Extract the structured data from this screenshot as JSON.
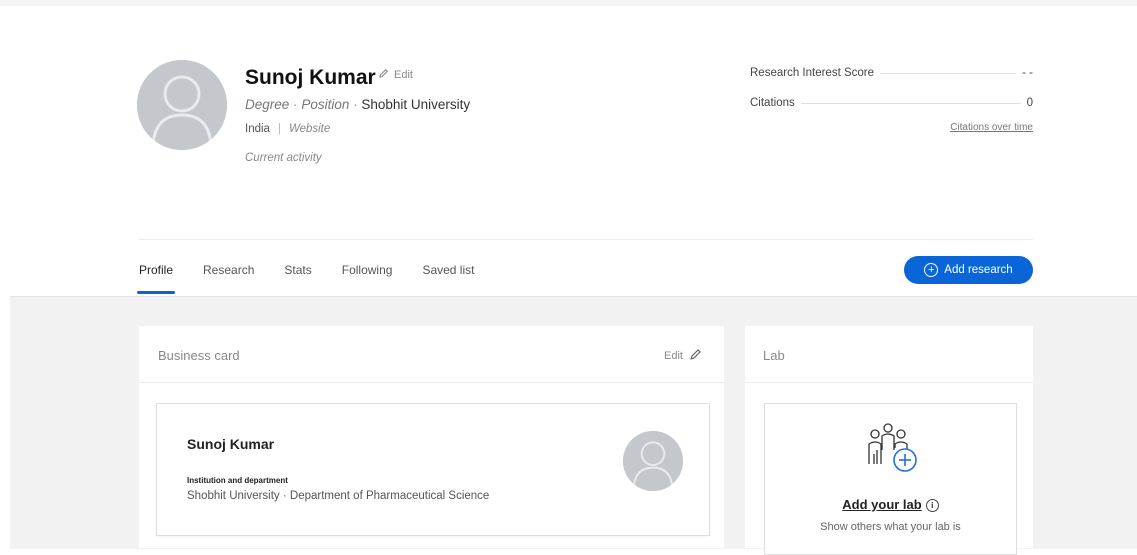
{
  "profile": {
    "name": "Sunoj Kumar",
    "edit_label": "Edit",
    "degree": "Degree",
    "position": "Position",
    "sep": "·",
    "university": "Shobhit University",
    "country": "India",
    "website": "Website",
    "current_activity": "Current activity"
  },
  "stats": {
    "ris_label": "Research Interest Score",
    "ris_value": "- -",
    "citations_label": "Citations",
    "citations_value": "0",
    "citations_link": "Citations over time"
  },
  "tabs": [
    {
      "label": "Profile",
      "active": true
    },
    {
      "label": "Research"
    },
    {
      "label": "Stats"
    },
    {
      "label": "Following"
    },
    {
      "label": "Saved list"
    }
  ],
  "add_research": "Add research",
  "business_card": {
    "title": "Business card",
    "edit_label": "Edit",
    "name": "Sunoj Kumar",
    "institution_label": "Institution and department",
    "institution_value": "Shobhit University · Department of Pharmaceutical Science"
  },
  "lab": {
    "title": "Lab",
    "add_lab": "Add your lab",
    "description": "Show others what your lab is"
  },
  "colors": {
    "accent": "#0a66d8",
    "avatar": "#c4c7cc",
    "background_grey": "#f2f2f2"
  }
}
